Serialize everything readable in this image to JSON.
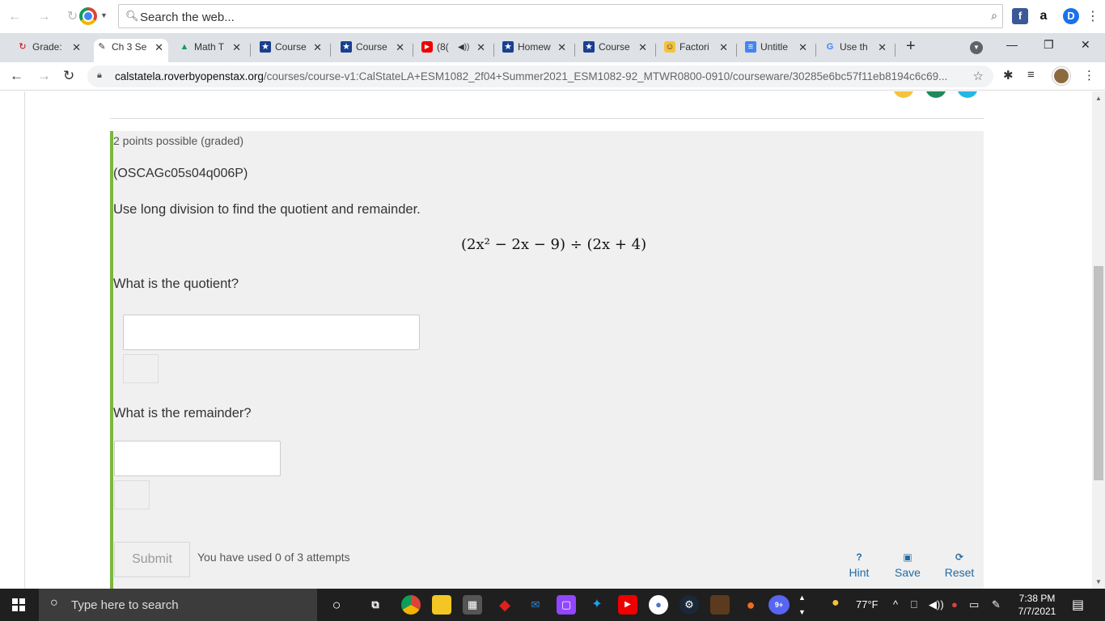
{
  "toolbar": {
    "search_placeholder": "Search the web...",
    "extensions": [
      "f",
      "a",
      "D"
    ]
  },
  "tabs": [
    {
      "label": "Grade:",
      "icon": "↻"
    },
    {
      "label": "Ch 3 Se",
      "icon": "✎"
    },
    {
      "label": "Math T",
      "icon": "▲"
    },
    {
      "label": "Course",
      "icon": "★"
    },
    {
      "label": "Course",
      "icon": "★"
    },
    {
      "label": "(8(",
      "icon": "▶"
    },
    {
      "label": "Homew",
      "icon": "★"
    },
    {
      "label": "Course",
      "icon": "★"
    },
    {
      "label": "Factori",
      "icon": "☺"
    },
    {
      "label": "Untitle",
      "icon": "≡"
    },
    {
      "label": "Use th",
      "icon": "G"
    }
  ],
  "address": {
    "domain": "calstatela.roverbyopenstax.org",
    "path": "/courses/course-v1:CalStateLA+ESM1082_2f04+Summer2021_ESM1082-92_MTWR0800-0910/courseware/30285e6bc57f11eb8194c6c69..."
  },
  "problem": {
    "points": "2 points possible (graded)",
    "id": "(OSCAGc05s04q006P)",
    "prompt": "Use long division to find the quotient and remainder.",
    "formula": "(2x² − 2x − 9) ÷ (2x + 4)",
    "q_quotient": "What is the quotient?",
    "q_remainder": "What is the remainder?",
    "quotient_value": "",
    "remainder_value": "",
    "submit": "Submit",
    "attempts": "You have used 0 of 3 attempts",
    "hint": "Hint",
    "save": "Save",
    "reset": "Reset"
  },
  "taskbar": {
    "search_placeholder": "Type here to search",
    "weather": "77°F",
    "time": "7:38 PM",
    "date": "7/7/2021",
    "badge": "9+"
  },
  "colors": {
    "accent_green": "#7ab83b",
    "link_blue": "#1f6aa5"
  }
}
